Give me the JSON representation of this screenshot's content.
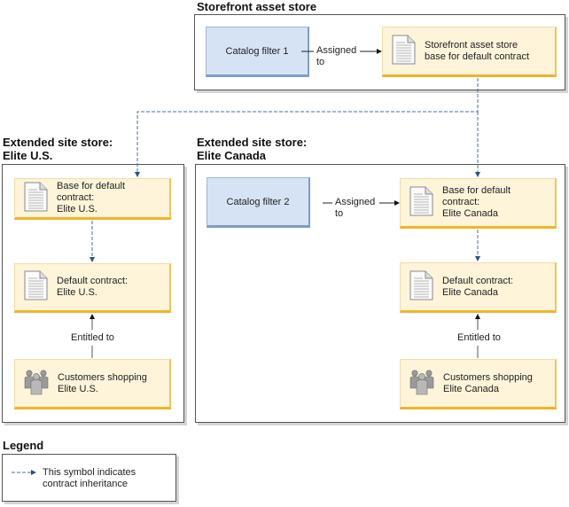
{
  "colors": {
    "inheritance_line": "#4a6ea8",
    "blue_fill": "#d6e3f4",
    "yellow_fill": "#fdf4d9",
    "yellow_border": "#f0b428"
  },
  "storefront": {
    "title": "Storefront asset store",
    "catalog_filter": "Catalog filter 1",
    "assigned_label_1": "Assigned",
    "assigned_label_2": "to",
    "base_contract_1": "Storefront asset store",
    "base_contract_2": "base for default contract"
  },
  "elite_us": {
    "title_1": "Extended site store:",
    "title_2": "Elite U.S.",
    "base_contract_1": "Base for default",
    "base_contract_2": "contract:",
    "base_contract_3": "Elite U.S.",
    "default_contract_1": "Default contract:",
    "default_contract_2": "Elite U.S.",
    "entitled_label": "Entitled to",
    "customers_1": "Customers shopping",
    "customers_2": "Elite U.S."
  },
  "elite_canada": {
    "title_1": "Extended site store:",
    "title_2": "Elite Canada",
    "catalog_filter": "Catalog filter 2",
    "assigned_label_1": "Assigned",
    "assigned_label_2": "to",
    "base_contract_1": "Base for default",
    "base_contract_2": "contract:",
    "base_contract_3": "Elite Canada",
    "default_contract_1": "Default contract:",
    "default_contract_2": "Elite Canada",
    "entitled_label": "Entitled to",
    "customers_1": "Customers shopping",
    "customers_2": "Elite Canada"
  },
  "legend": {
    "title": "Legend",
    "text_1": "This symbol indicates",
    "text_2": "contract inheritance"
  },
  "icons": {
    "document": "document-icon",
    "customers": "customer-group-icon"
  }
}
